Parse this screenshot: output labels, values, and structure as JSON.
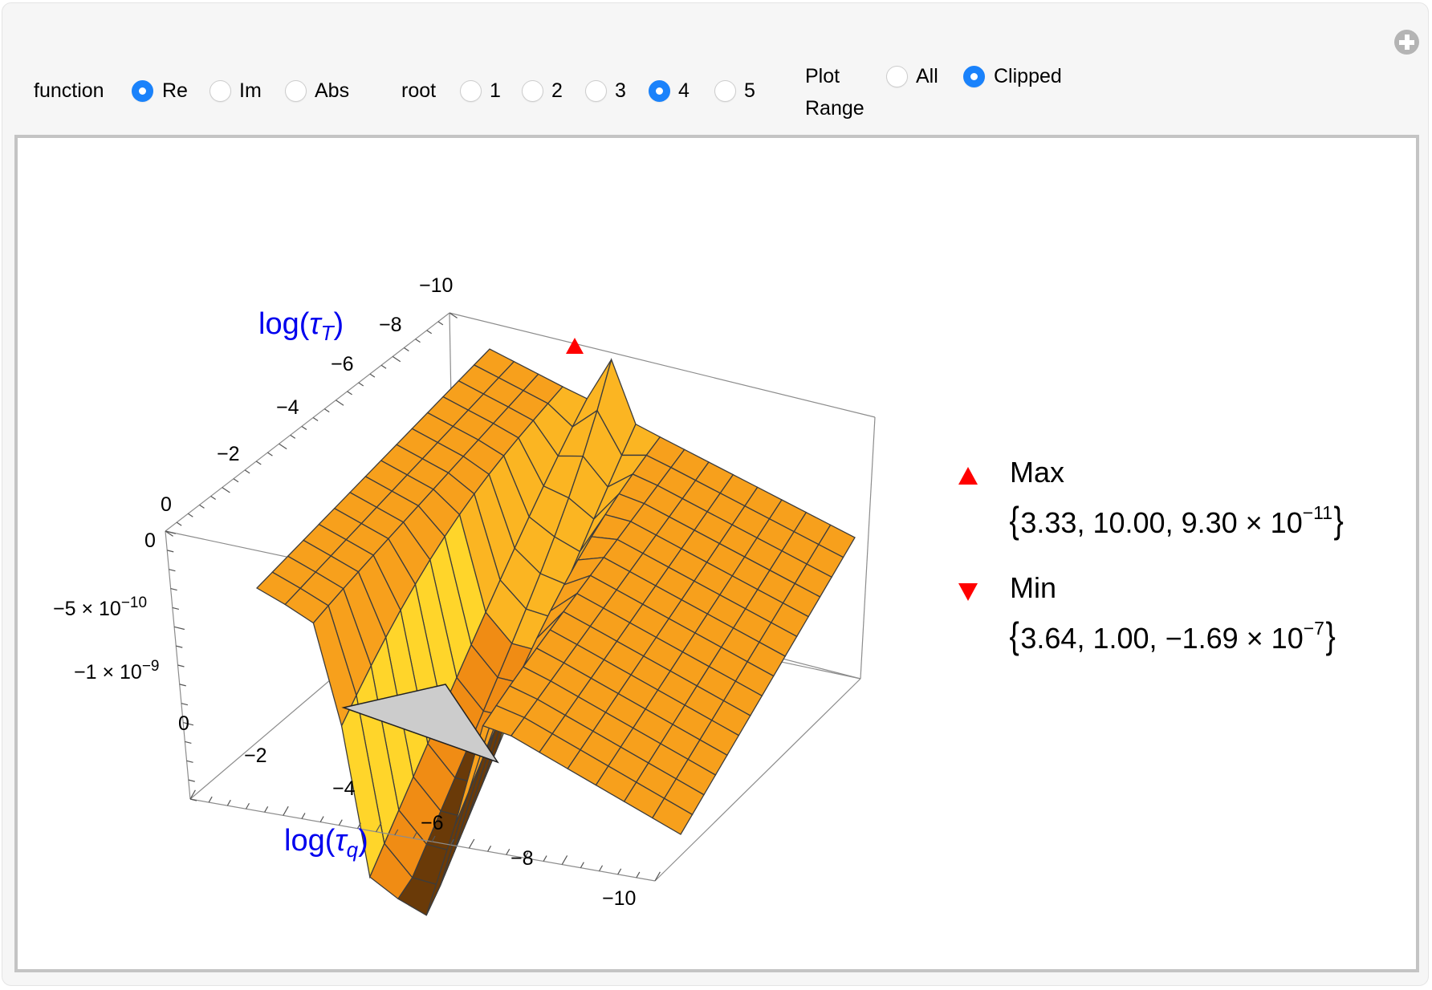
{
  "controls": {
    "function": {
      "label": "function",
      "options": [
        {
          "label": "Re",
          "selected": true
        },
        {
          "label": "Im",
          "selected": false
        },
        {
          "label": "Abs",
          "selected": false
        }
      ]
    },
    "root": {
      "label": "root",
      "options": [
        {
          "label": "1",
          "selected": false
        },
        {
          "label": "2",
          "selected": false
        },
        {
          "label": "3",
          "selected": false
        },
        {
          "label": "4",
          "selected": true
        },
        {
          "label": "5",
          "selected": false
        }
      ]
    },
    "plot_range": {
      "label_line1": "Plot",
      "label_line2": "Range",
      "options": [
        {
          "label": "All",
          "selected": false
        },
        {
          "label": "Clipped",
          "selected": true
        }
      ]
    },
    "plus_button": "plus-icon"
  },
  "colors": {
    "accent": "#1a82fb",
    "surface": "#f7a21c",
    "surface_highlight": "#ffe033",
    "surface_shadow": "#5a3208",
    "marker": "#ff0000",
    "axis_title": "#0000ee",
    "clip_fill": "#cccccc"
  },
  "chart_data": {
    "type": "surface3d",
    "x_axis": {
      "label_main": "log(",
      "label_sub": "q",
      "label_greek": "τ",
      "label_close": ")",
      "ticks": [
        "0",
        "−2",
        "−4",
        "−6",
        "−8",
        "−10"
      ],
      "range": [
        0,
        -10
      ]
    },
    "y_axis": {
      "label_main": "log(",
      "label_sub": "T",
      "label_greek": "τ",
      "label_close": ")",
      "ticks": [
        "0",
        "−2",
        "−4",
        "−6",
        "−8",
        "−10"
      ],
      "range": [
        0,
        -10
      ]
    },
    "z_axis": {
      "ticks": [
        {
          "mantissa": "0",
          "exp": ""
        },
        {
          "mantissa": "−5 × 10",
          "exp": "−10"
        },
        {
          "mantissa": "−1 × 10",
          "exp": "−9"
        }
      ],
      "range": [
        -1.4e-09,
        0
      ],
      "clipped": true
    },
    "mesh": {
      "rows": 15,
      "cols": 15
    },
    "features": "Ridge along log(τq) ≈ -3.3 rising toward log(τT) = -10; deep trough near log(τq) ≈ -3.6, log(τT) ≈ -1, clipped below the plot range",
    "extrema": {
      "max": {
        "label": "Max",
        "marker": "triangle-up",
        "values": [
          "3.33",
          "10.00",
          "9.30 × 10"
        ],
        "exp": "−11",
        "text": "{3.33, 10.00, 9.30 × 10^−11}"
      },
      "min": {
        "label": "Min",
        "marker": "triangle-down",
        "values": [
          "3.64",
          "1.00",
          "−1.69 × 10"
        ],
        "exp": "−7",
        "text": "{3.64, 1.00, −1.69 × 10^−7}"
      }
    }
  }
}
